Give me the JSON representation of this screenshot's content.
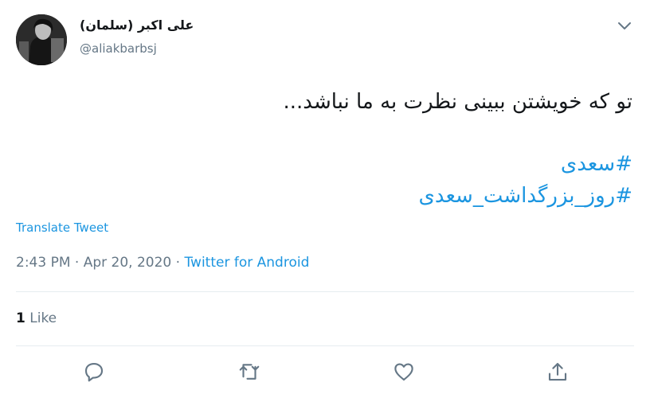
{
  "tweet": {
    "display_name": "علی اکبر (سلمان)",
    "handle": "@aliakbarbsj",
    "text": "تو که خویشتن ببینی نظرت به ما نباشد...",
    "hashtags": [
      "#سعدی",
      "#روز_بزرگداشت_سعدی"
    ],
    "translate_label": "Translate Tweet",
    "time": "2:43 PM",
    "date": "Apr 20, 2020",
    "separator": "·",
    "source": "Twitter for Android",
    "like_count": "1",
    "like_label": "Like"
  },
  "icons": {
    "avatar": "avatar",
    "caret": "chevron-down-icon",
    "reply": "reply-icon",
    "retweet": "retweet-icon",
    "like": "heart-icon",
    "share": "share-icon"
  },
  "colors": {
    "link": "#1b95e0",
    "muted": "#657786",
    "text": "#14171a",
    "divider": "#e6ecf0"
  }
}
